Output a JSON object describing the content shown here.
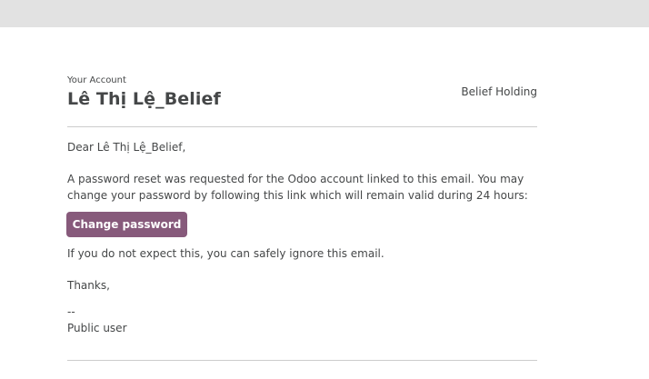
{
  "header": {
    "account_label": "Your Account",
    "user_name": "Lê Thị Lệ_Belief",
    "company_logo_alt": "Belief Holding"
  },
  "body": {
    "greeting": "Dear Lê Thị Lệ_Belief,",
    "reset_line1": "A password reset was requested for the Odoo account linked to this email. You may",
    "reset_line2": "change your password by following this link which will remain valid during 24 hours:",
    "button_label": "Change password",
    "ignore_text": "If you do not expect this, you can safely ignore this email.",
    "thanks": "Thanks,",
    "signature_dash": "--",
    "signature_name": "Public user"
  },
  "colors": {
    "button_bg": "#875a7b",
    "top_bar": "#e2e2e2",
    "text": "#454748",
    "divider": "#cccccc"
  }
}
